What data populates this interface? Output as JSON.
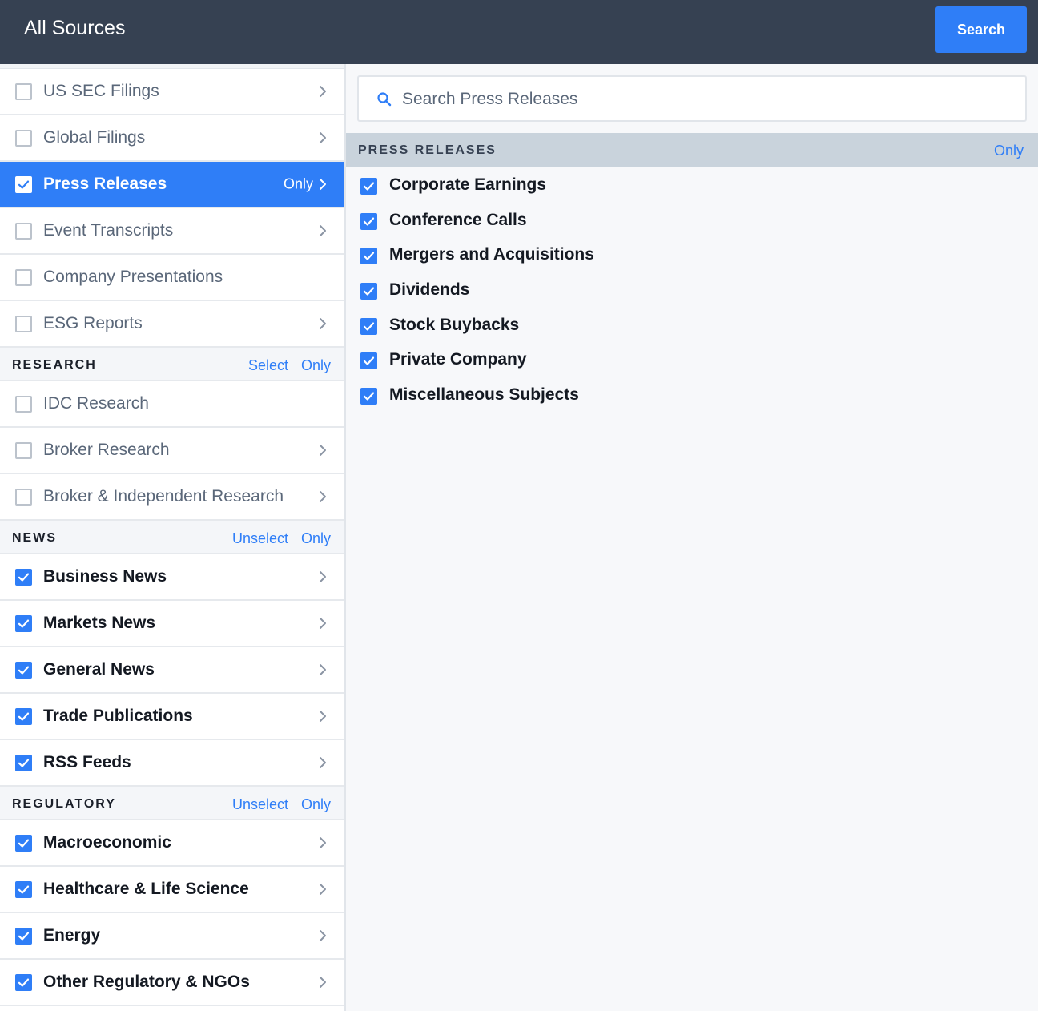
{
  "header": {
    "title": "All Sources",
    "search_label": "Search"
  },
  "sidebar": {
    "groups": [
      {
        "title": "",
        "links": [],
        "items": [
          {
            "label": "US SEC Filings",
            "checked": false,
            "chevron": true
          },
          {
            "label": "Global Filings",
            "checked": false,
            "chevron": true
          },
          {
            "label": "Press Releases",
            "checked": true,
            "chevron": true,
            "active": true,
            "only_label": "Only"
          },
          {
            "label": "Event Transcripts",
            "checked": false,
            "chevron": true
          },
          {
            "label": "Company Presentations",
            "checked": false,
            "chevron": false
          },
          {
            "label": "ESG Reports",
            "checked": false,
            "chevron": true
          }
        ]
      },
      {
        "title": "RESEARCH",
        "links": [
          "Select",
          "Only"
        ],
        "items": [
          {
            "label": "IDC Research",
            "checked": false,
            "chevron": false
          },
          {
            "label": "Broker Research",
            "checked": false,
            "chevron": true
          },
          {
            "label": "Broker & Independent Research",
            "checked": false,
            "chevron": true
          }
        ]
      },
      {
        "title": "NEWS",
        "links": [
          "Unselect",
          "Only"
        ],
        "items": [
          {
            "label": "Business News",
            "checked": true,
            "chevron": true
          },
          {
            "label": "Markets News",
            "checked": true,
            "chevron": true
          },
          {
            "label": "General News",
            "checked": true,
            "chevron": true
          },
          {
            "label": "Trade Publications",
            "checked": true,
            "chevron": true
          },
          {
            "label": "RSS Feeds",
            "checked": true,
            "chevron": true
          }
        ]
      },
      {
        "title": "REGULATORY",
        "links": [
          "Unselect",
          "Only"
        ],
        "items": [
          {
            "label": "Macroeconomic",
            "checked": true,
            "chevron": true
          },
          {
            "label": "Healthcare & Life Science",
            "checked": true,
            "chevron": true
          },
          {
            "label": "Energy",
            "checked": true,
            "chevron": true
          },
          {
            "label": "Other Regulatory & NGOs",
            "checked": true,
            "chevron": true
          }
        ]
      }
    ]
  },
  "main": {
    "search_placeholder": "Search Press Releases",
    "section_title": "PRESS RELEASES",
    "only_label": "Only",
    "items": [
      {
        "label": "Corporate Earnings",
        "checked": true
      },
      {
        "label": "Conference Calls",
        "checked": true
      },
      {
        "label": "Mergers and Acquisitions",
        "checked": true
      },
      {
        "label": "Dividends",
        "checked": true
      },
      {
        "label": "Stock Buybacks",
        "checked": true
      },
      {
        "label": "Private Company",
        "checked": true
      },
      {
        "label": "Miscellaneous Subjects",
        "checked": true
      }
    ]
  },
  "icons": {
    "checkbox_checked": "check-icon",
    "chevron": "chevron-right-icon",
    "search": "search-icon"
  },
  "colors": {
    "accent": "#2f7ef7",
    "header_bg": "#364152",
    "section_bg": "#c9d3dc"
  }
}
